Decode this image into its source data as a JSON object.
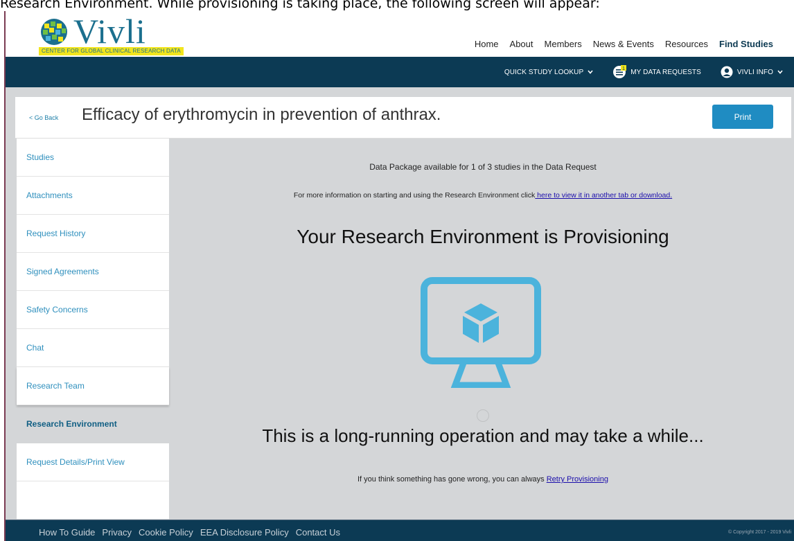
{
  "caption": "Research Environment. While provisioning is taking place, the following screen will appear:",
  "logo": {
    "word": "Vivli",
    "tagline": "CENTER FOR GLOBAL CLINICAL RESEARCH DATA"
  },
  "topnav": [
    "Home",
    "About",
    "Members",
    "News & Events",
    "Resources",
    "Find Studies"
  ],
  "subbar": {
    "quick_lookup": "QUICK STUDY LOOKUP",
    "data_requests": "MY DATA REQUESTS",
    "user": "VIVLI INFO",
    "badge": "1"
  },
  "titlebar": {
    "back": "< Go Back",
    "title": "Efficacy of erythromycin in prevention of anthrax.",
    "print": "Print"
  },
  "sidebar": [
    "Studies",
    "Attachments",
    "Request History",
    "Signed Agreements",
    "Safety Concerns",
    "Chat",
    "Research Team",
    "Research Environment",
    "Request Details/Print View"
  ],
  "main": {
    "availability": "Data Package available for 1 of 3 studies in the Data Request",
    "info_prefix": "For more information on starting and using the Research Environment click",
    "info_link": " here to view it in another tab or download.",
    "headline": "Your Research Environment is Provisioning",
    "longrun": "This is a long-running operation and may take a while...",
    "retry_prefix": "If you think something has gone wrong, you can always ",
    "retry_link": "Retry Provisioning"
  },
  "footer": {
    "links": [
      "How To Guide",
      "Privacy",
      "Cookie Policy",
      "EEA Disclosure Policy",
      "Contact Us"
    ],
    "copyright": "© Copyright 2017 - 2019 Vivli"
  },
  "colors": {
    "brand_navy": "#0c3a54",
    "link_blue": "#2e8fbd",
    "accent": "#4bb3dc",
    "print": "#1f8cc2",
    "logo_yellow": "#f2e51d"
  }
}
